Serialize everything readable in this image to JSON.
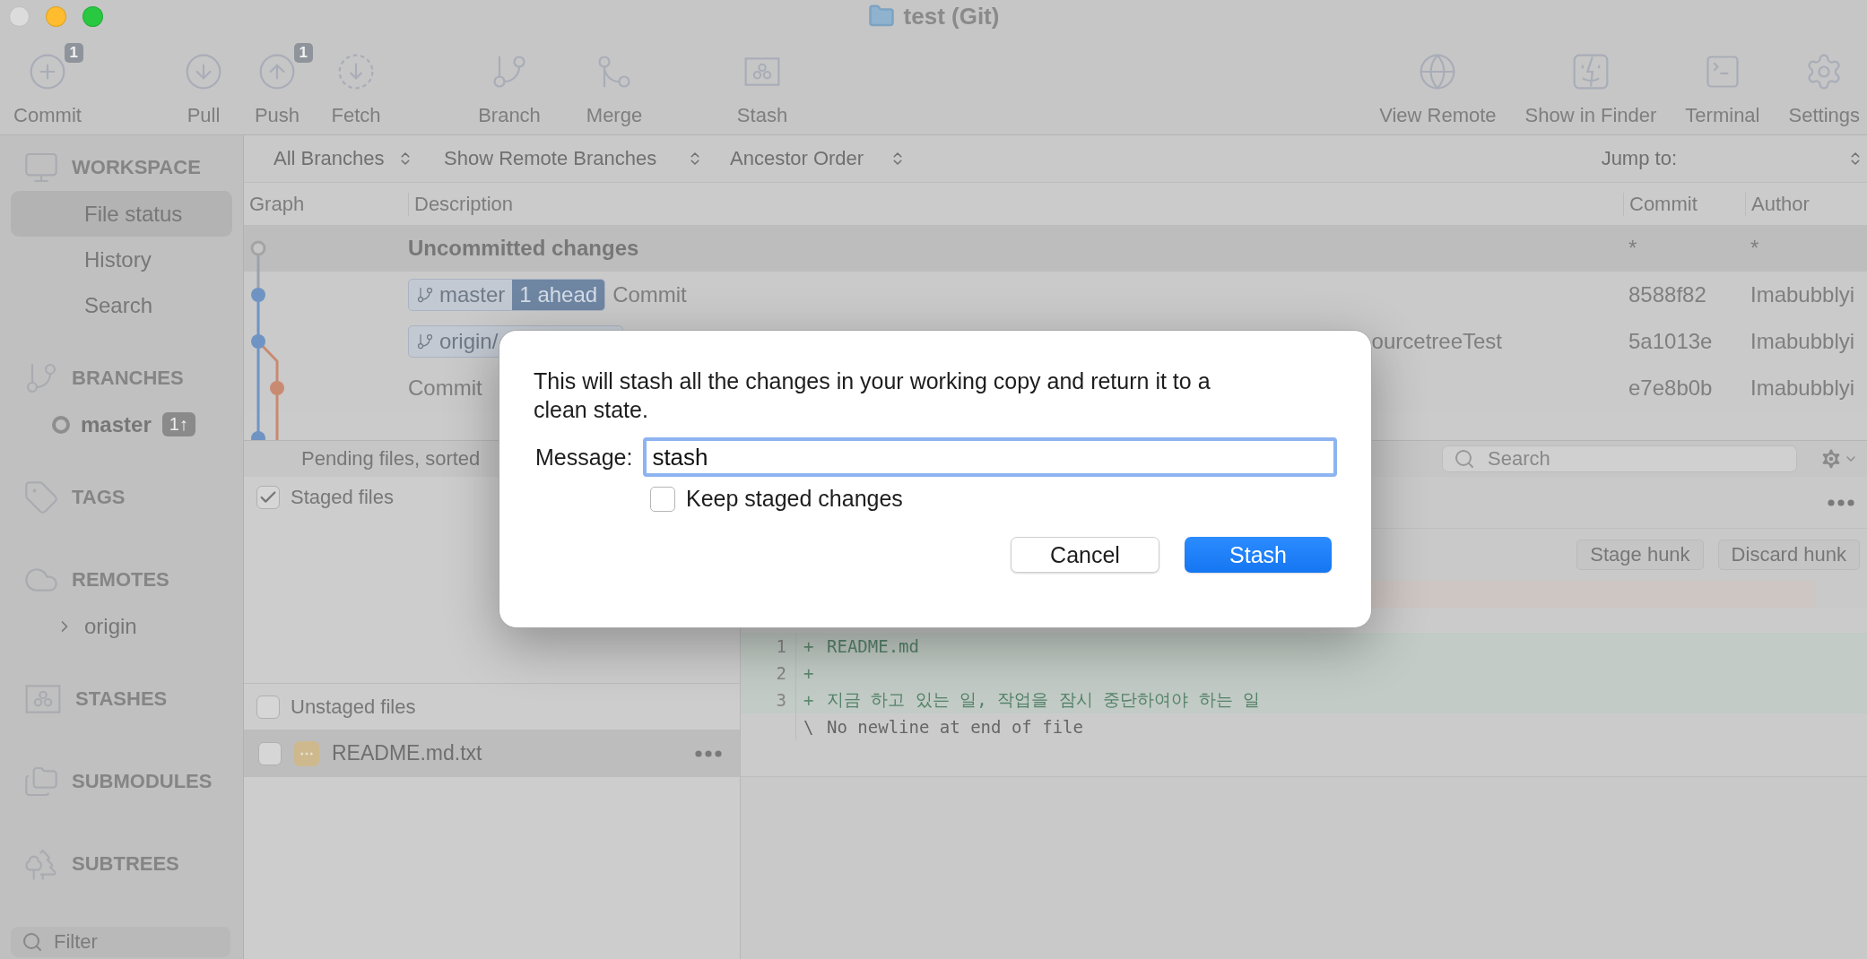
{
  "window": {
    "title": "test (Git)"
  },
  "toolbar": {
    "left": [
      {
        "label": "Commit",
        "badge": "1"
      },
      {
        "label": "Pull"
      },
      {
        "label": "Push",
        "badge": "1"
      },
      {
        "label": "Fetch"
      },
      {
        "label": "Branch"
      },
      {
        "label": "Merge"
      },
      {
        "label": "Stash"
      }
    ],
    "right": [
      {
        "label": "View Remote"
      },
      {
        "label": "Show in Finder"
      },
      {
        "label": "Terminal"
      },
      {
        "label": "Settings"
      }
    ]
  },
  "sidebar": {
    "sections": [
      {
        "label": "WORKSPACE",
        "items": [
          {
            "label": "File status",
            "kind": "nav",
            "selected": true
          },
          {
            "label": "History",
            "kind": "nav",
            "selected": false
          },
          {
            "label": "Search",
            "kind": "nav",
            "selected": false
          }
        ]
      },
      {
        "label": "BRANCHES",
        "items": [
          {
            "label": "master",
            "kind": "branch",
            "badge": "1↑",
            "selected": false
          }
        ]
      },
      {
        "label": "TAGS"
      },
      {
        "label": "REMOTES",
        "items": [
          {
            "label": "origin",
            "kind": "remote",
            "selected": false
          }
        ]
      },
      {
        "label": "STASHES"
      },
      {
        "label": "SUBMODULES"
      },
      {
        "label": "SUBTREES"
      }
    ],
    "filter": {
      "placeholder": "Filter"
    }
  },
  "filter_bar": {
    "branches": "All Branches",
    "remote": "Show Remote Branches",
    "order": "Ancestor Order",
    "jump_label": "Jump to:"
  },
  "table": {
    "columns": [
      "Graph",
      "Description",
      "Commit",
      "Author"
    ],
    "rows": [
      {
        "kind": "uncommitted",
        "description": "Uncommitted changes",
        "commit": "*",
        "author": "*"
      },
      {
        "kind": "commit",
        "tags": [
          {
            "label": "master",
            "ahead": "1 ahead"
          }
        ],
        "description": "Commit",
        "commit": "8588f82",
        "author": "Imabubblyi"
      },
      {
        "kind": "commit",
        "tags": [
          {
            "label": "origin/"
          }
        ],
        "description_tail": "ourcetreeTest",
        "commit": "5a1013e",
        "author": "Imabubblyi"
      },
      {
        "kind": "commit",
        "description": "Commit",
        "commit": "e7e8b0b",
        "author": "Imabubblyi"
      }
    ]
  },
  "pending": {
    "label": "Pending files, sorted",
    "search_placeholder": "Search"
  },
  "staged": {
    "label": "Staged files",
    "checked": true
  },
  "unstaged": {
    "label": "Unstaged files",
    "checked": false,
    "files": [
      {
        "name": "README.md.txt",
        "checked": false,
        "selected": true
      }
    ]
  },
  "diff": {
    "buttons": [
      "Stage hunk",
      "Discard hunk"
    ],
    "lines": [
      {
        "kind": "added",
        "number": "1",
        "marker": "+",
        "text": "README.md"
      },
      {
        "kind": "added",
        "number": "2",
        "marker": "+"
      },
      {
        "kind": "added",
        "number": "3",
        "marker": "+",
        "text": "지금 하고 있는 일, 작업을 잠시 중단하여야 하는 일"
      },
      {
        "kind": "note",
        "marker": "\\",
        "text": "No newline at end of file"
      }
    ]
  },
  "dialog": {
    "message": "This will stash all the changes in your working copy and return it to a clean state.",
    "field_label": "Message:",
    "value": "stash",
    "keep": {
      "label": "Keep staged changes",
      "checked": false
    },
    "buttons": [
      {
        "label": "Cancel",
        "kind": "secondary"
      },
      {
        "label": "Stash",
        "kind": "primary"
      }
    ]
  }
}
